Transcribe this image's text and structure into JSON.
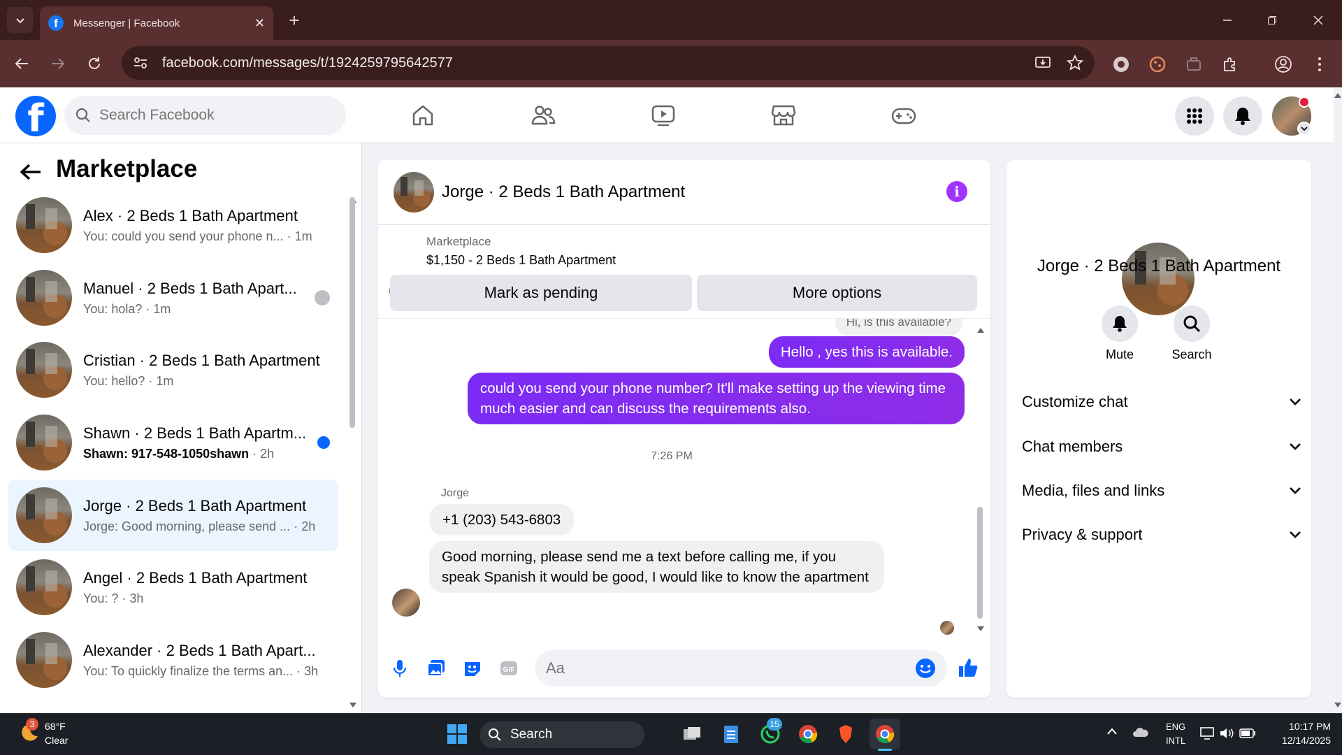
{
  "browser": {
    "tab_title": "Messenger | Facebook",
    "url": "facebook.com/messages/t/1924259795642577"
  },
  "fb": {
    "search_placeholder": "Search Facebook",
    "nav_icons": [
      "home-icon",
      "friends-icon",
      "watch-icon",
      "marketplace-icon",
      "gaming-icon"
    ]
  },
  "left": {
    "title": "Marketplace",
    "conversations": [
      {
        "name": "Alex · 2 Beds 1 Bath Apartment",
        "preview": "You: could you send your phone n...",
        "time": "1m",
        "unread": false
      },
      {
        "name": "Manuel · 2 Beds 1 Bath Apart...",
        "preview": "You: hola?",
        "time": "1m",
        "unread": false
      },
      {
        "name": "Cristian · 2 Beds 1 Bath Apartment",
        "preview": "You: hello?",
        "time": "1m",
        "unread": false
      },
      {
        "name": "Shawn · 2 Beds 1 Bath Apartm...",
        "preview": "Shawn: 917-548-1050shawn",
        "time": "2h",
        "unread": true
      },
      {
        "name": "Jorge · 2 Beds 1 Bath Apartment",
        "preview": "Jorge: Good morning, please send ...",
        "time": "2h",
        "unread": false
      },
      {
        "name": "Angel · 2 Beds 1 Bath Apartment",
        "preview": "You: ?",
        "time": "3h",
        "unread": false
      },
      {
        "name": "Alexander · 2 Beds 1 Bath Apart...",
        "preview": "You: To quickly finalize the terms an...",
        "time": "3h",
        "unread": false
      }
    ]
  },
  "chat": {
    "title": "Jorge · 2 Beds 1 Bath Apartment",
    "marketplace_label": "Marketplace",
    "listing": "$1,150 - 2 Beds 1 Bath Apartment",
    "mark_pending": "Mark as pending",
    "more_options": "More options",
    "partial_msg": "Hi, is this available?",
    "msg_out_1": "Hello , yes this is available.",
    "msg_out_2": "could you send your phone number? It'll make setting up the viewing time much easier and can discuss the requirements also.",
    "timestamp": "7:26 PM",
    "sender": "Jorge",
    "msg_in_1": "+1 (203) 543-6803",
    "msg_in_2": "Good morning, please send me a text before calling me, if you speak Spanish it would be good, I would like to know the apartment",
    "composer_placeholder": "Aa"
  },
  "right": {
    "title": "Jorge · 2 Beds 1 Bath Apartment",
    "mute": "Mute",
    "search": "Search",
    "sections": [
      "Customize chat",
      "Chat members",
      "Media, files and links",
      "Privacy & support"
    ]
  },
  "taskbar": {
    "weather_temp": "68°F",
    "weather_desc": "Clear",
    "weather_badge": "3",
    "search": "Search",
    "whatsapp_badge": "15",
    "lang1": "ENG",
    "lang2": "INTL",
    "time": "10:17 PM",
    "date": "12/14/2025"
  },
  "colors": {
    "fb_blue": "#0866ff",
    "messenger_purple": "#8a2be2",
    "chrome_frame": "#3a1e1e"
  }
}
